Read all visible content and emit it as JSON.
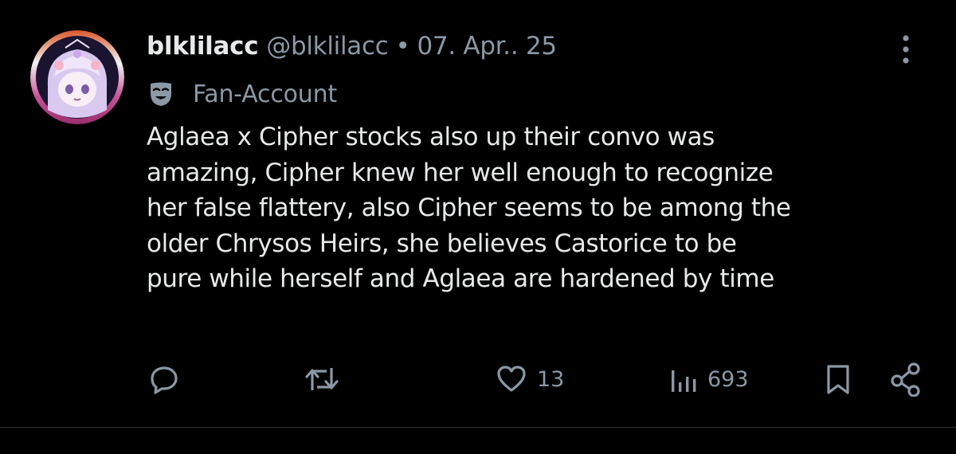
{
  "post": {
    "display_name": "blklilacc",
    "handle": "@blklilacc",
    "separator": "•",
    "date": "07. Apr.. 25",
    "label_icon": "theater-mask-icon",
    "label": "Fan-Account",
    "text": "Aglaea x Cipher stocks also up their convo was\namazing, Cipher knew her well enough to recognize\nher false flattery, also Cipher seems to be among the\nolder Chrysos Heirs, she believes Castorice to be\npure while herself and Aglaea are hardened by time"
  },
  "actions": {
    "reply": {
      "icon": "reply-icon"
    },
    "repost": {
      "icon": "repost-icon"
    },
    "like": {
      "icon": "heart-icon",
      "count": "13"
    },
    "views": {
      "icon": "views-icon",
      "count": "693"
    },
    "bookmark": {
      "icon": "bookmark-icon"
    },
    "share": {
      "icon": "share-icon"
    }
  },
  "colors": {
    "background": "#000000",
    "primary_text": "#e7e9ea",
    "secondary_text": "#8b98a5",
    "divider": "#2f3336"
  }
}
